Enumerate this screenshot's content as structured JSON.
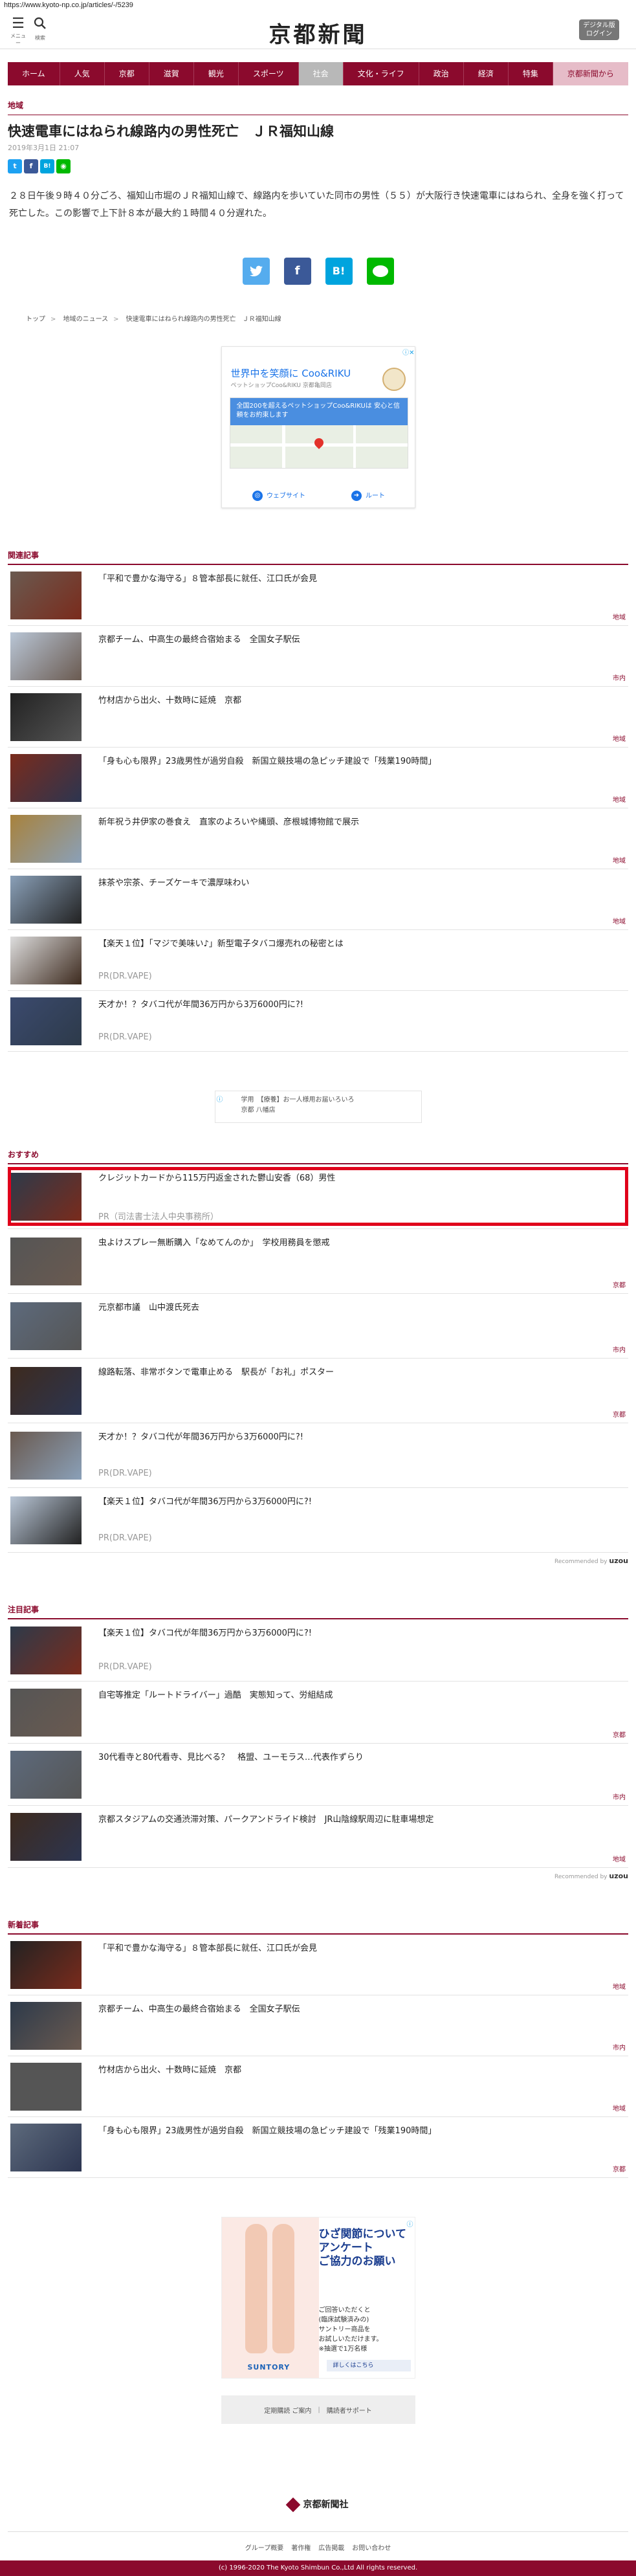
{
  "url": "https://www.kyoto-np.co.jp/articles/-/5239",
  "header": {
    "menu_caption": "メニュー",
    "search_caption": "検索",
    "logo": "京都新聞",
    "digital_button": "デジタル版\nログイン"
  },
  "nav": [
    "ホーム",
    "人気",
    "京都",
    "滋賀",
    "観光",
    "スポーツ",
    "社会",
    "文化・ライフ",
    "政治",
    "経済",
    "特集",
    "京都新聞から"
  ],
  "article": {
    "category": "地域",
    "headline": "快速電車にはねられ線路内の男性死亡　ＪＲ福知山線",
    "date": "2019年3月1日 21:07",
    "body": "２８日午後９時４０分ごろ、福知山市堀のＪＲ福知山線で、線路内を歩いていた同市の男性（５５）が大阪行き快速電車にはねられ、全身を強く打って死亡した。この影響で上下計８本が最大約１時間４０分遅れた。"
  },
  "breadcrumbs": [
    "トップ",
    "地域のニュース",
    "快速電車にはねられ線路内の男性死亡　ＪＲ福知山線"
  ],
  "ad1": {
    "title": "世界中を笑顔に Coo&RIKU",
    "subtitle": "ペットショップCoo&RIKU 京都亀岡店",
    "band": "全国200を超えるペットショップCoo&RIKUは 安心と信頼をお約束します",
    "link1": "ウェブサイト",
    "link2": "ルート"
  },
  "sections": {
    "related": "関連記事",
    "recommend": "おすすめ",
    "attention": "注目記事",
    "latest": "新着記事"
  },
  "related": [
    {
      "text": "「平和で豊かな海守る」８管本部長に就任、江口氏が会見",
      "tag": "地域"
    },
    {
      "text": "京都チーム、中高生の最終合宿始まる　全国女子駅伝",
      "tag": "市内"
    },
    {
      "text": "竹材店から出火、十数時に延焼　京都",
      "tag": "地域"
    },
    {
      "text": "「身も心も限界」23歳男性が過労自殺　新国立競技場の急ピッチ建設で「残業190時間」",
      "tag": "地域"
    },
    {
      "text": "新年祝う井伊家の巻食え　直家のよろいや縄頭、彦根城博物館で展示",
      "tag": "地域"
    },
    {
      "text": "抹茶や宗茶、チーズケーキで濃厚味わい",
      "tag": "地域"
    },
    {
      "text": "【楽天１位】「マジで美味い♪」新型電子タバコ爆売れの秘密とは",
      "pr": "PR(DR.VAPE)"
    },
    {
      "text": "天才か！？タバコ代が年間36万円から3万6000円に?!",
      "pr": "PR(DR.VAPE)"
    }
  ],
  "ad2": {
    "choice": "ⓘ",
    "title": "学用　【療養】お一人様用お届いろいろ",
    "sub": "京都 八幡店"
  },
  "recommend": [
    {
      "text": "クレジットカードから115万円返金された鬱山安香（68）男性",
      "pr": "PR（司法書士法人中央事務所）"
    },
    {
      "text": "虫よけスプレー無断購入「なめてんのか」　学校用務員を懲戒",
      "tag": "京都"
    },
    {
      "text": "元京都市議　山中渡氏死去",
      "tag": "市内"
    },
    {
      "text": "線路転落、非常ボタンで電車止める　駅長が「お礼」ポスター",
      "tag": "京都"
    },
    {
      "text": "天才か！？タバコ代が年間36万円から3万6000円に?!",
      "pr": "PR(DR.VAPE)"
    },
    {
      "text": "【楽天１位】タバコ代が年間36万円から3万6000円に?!",
      "pr": "PR(DR.VAPE)"
    }
  ],
  "recommended_by": "Recommended by",
  "recommended_brand": "uzou",
  "attention": [
    {
      "text": "【楽天１位】タバコ代が年間36万円から3万6000円に?!",
      "pr": "PR(DR.VAPE)"
    },
    {
      "text": "自宅等推定「ルートドライバー」過酷　実態知って、労組結成",
      "tag": "京都"
    },
    {
      "text": "30代看寺と80代看寺、見比べる？　格盟、ユーモラス…代表作ずらり",
      "tag": "市内"
    },
    {
      "text": "京都スタジアムの交通渋滞対策、パークアンドライド検討　JR山陰線駅周辺に駐車場想定",
      "tag": "地域"
    }
  ],
  "latest": [
    {
      "text": "「平和で豊かな海守る」８管本部長に就任、江口氏が会見",
      "tag": "地域"
    },
    {
      "text": "京都チーム、中高生の最終合宿始まる　全国女子駅伝",
      "tag": "市内"
    },
    {
      "text": "竹材店から出火、十数時に延焼　京都",
      "tag": "地域"
    },
    {
      "text": "「身も心も限界」23歳男性が過労自殺　新国立競技場の急ピッチ建設で「残業190時間」",
      "tag": "京都"
    }
  ],
  "ad3": {
    "headline": "ひざ関節について\nアンケート\nご協力のお願い",
    "body": "ご回答いただくと\n(臨床試験済みの)\nサントリー商品を\nお試しいただけます。\n※抽選で1万名様",
    "brand": "SUNTORY",
    "more": "詳しくはこちら"
  },
  "subbar": [
    "定期購読 ご案内",
    "購読者サポート"
  ],
  "footer": {
    "logo": "京都新聞社",
    "links": [
      "グループ概要",
      "著作権",
      "広告掲載",
      "お問い合わせ"
    ],
    "copyright": "(c) 1996-2020 The Kyoto Shimbun Co.,Ltd All rights reserved."
  },
  "colors": {
    "brand": "#8b0a2d",
    "highlight": "#e0001b"
  }
}
